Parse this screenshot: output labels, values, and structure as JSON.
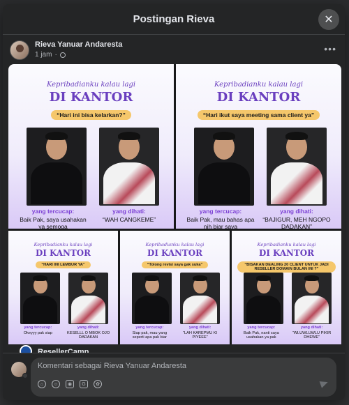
{
  "modal": {
    "title": "Postingan Rieva",
    "close_icon": "close-icon"
  },
  "post": {
    "author": "Rieva Yanuar Andaresta",
    "time": "1 jam",
    "audience_icon": "globe-icon",
    "more_icon": "ellipsis-icon"
  },
  "tiles": [
    {
      "kp": "Kepribadianku kalau lagi",
      "dk": "DI KANTOR",
      "bubble": "“Hari ini bisa kelarkan?”",
      "label_left": "yang tercucap:",
      "text_left": "Baik Pak, saya usahakan ya semoga",
      "label_right": "yang dihati:",
      "text_right": "“WAH CANGKEME”"
    },
    {
      "kp": "Kepribadianku kalau lagi",
      "dk": "DI KANTOR",
      "bubble": "“Hari ikut saya meeting sama client ya”",
      "label_left": "yang tercucap:",
      "text_left": "Baik Pak, mau bahas apa nih biar saya",
      "label_right": "yang dihati:",
      "text_right": "“BAJIGUR, MEH NGOPO DADAKAN”"
    },
    {
      "kp": "Kepribadianku kalau lagi",
      "dk": "DI KANTOR",
      "bubble": "“HARI INI LEMBUR YA”",
      "label_left": "yang tercucap:",
      "text_left": "Okeyyy pak siap",
      "label_right": "yang dihati:",
      "text_right": "KESELLL O MBOK OJO DADAKAN"
    },
    {
      "kp": "Kepribadianku kalau lagi",
      "dk": "DI KANTOR",
      "bubble": "“Tolong revisi saya gak suka”",
      "label_left": "yang tercucap:",
      "text_left": "Siap pak, mau yang seperti apa pak biar",
      "label_right": "yang dihati:",
      "text_right": "“LAH KAREPMU KI PIYEEE”"
    },
    {
      "kp": "Kepribadianku kalau lagi",
      "dk": "DI KANTOR",
      "bubble": "“BISAKAN DEALING 20 CLIENT UNTUK JADI RESELLER DOMAIN BULAN INI ?”",
      "label_left": "yang tercucap:",
      "text_left": "Baik Pak, nanti saya usahakan ya pak",
      "label_right": "yang dihati:",
      "text_right": "“WLUWLUWLU PIKIR DHEWE”"
    }
  ],
  "next_post": {
    "name": "ResellerCamp"
  },
  "comment": {
    "placeholder": "Komentari sebagai Rieva Yanuar Andaresta",
    "icons": [
      "sticker-icon",
      "emoji-icon",
      "camera-icon",
      "gif-icon",
      "avatar-sticker-icon"
    ],
    "send_icon": "send-icon"
  }
}
